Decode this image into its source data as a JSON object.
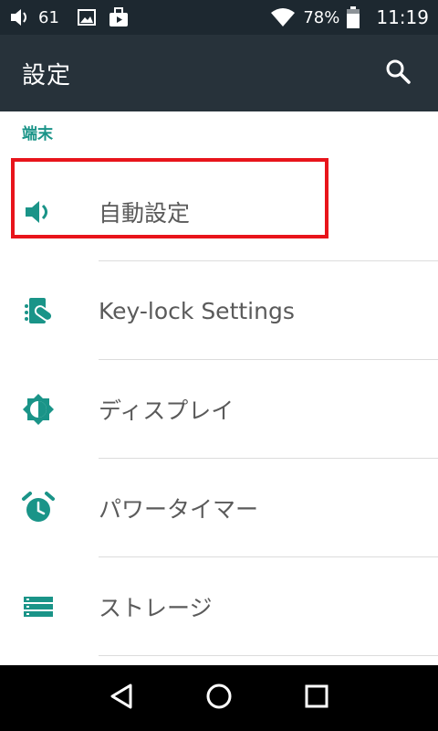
{
  "status_bar": {
    "volume_level": "61",
    "battery_percent": "78%",
    "time": "11:19",
    "icons": [
      "volume-icon",
      "image-icon",
      "bag-icon",
      "wifi-icon",
      "battery-icon"
    ]
  },
  "toolbar": {
    "title": "設定",
    "search_icon": "search-icon"
  },
  "section": {
    "header": "端末"
  },
  "items": [
    {
      "label": "自動設定",
      "icon": "speaker-icon"
    },
    {
      "label": "Key-lock Settings",
      "icon": "key-lock-icon"
    },
    {
      "label": "ディスプレイ",
      "icon": "brightness-icon"
    },
    {
      "label": "パワータイマー",
      "icon": "alarm-clock-icon"
    },
    {
      "label": "ストレージ",
      "icon": "storage-icon"
    }
  ],
  "colors": {
    "accent": "#1a9488",
    "toolbar": "#27323a",
    "status_bar": "#1d2830",
    "highlight": "#e8141b"
  },
  "nav_bar": {
    "icons": [
      "back-icon",
      "home-icon",
      "recents-icon"
    ]
  }
}
